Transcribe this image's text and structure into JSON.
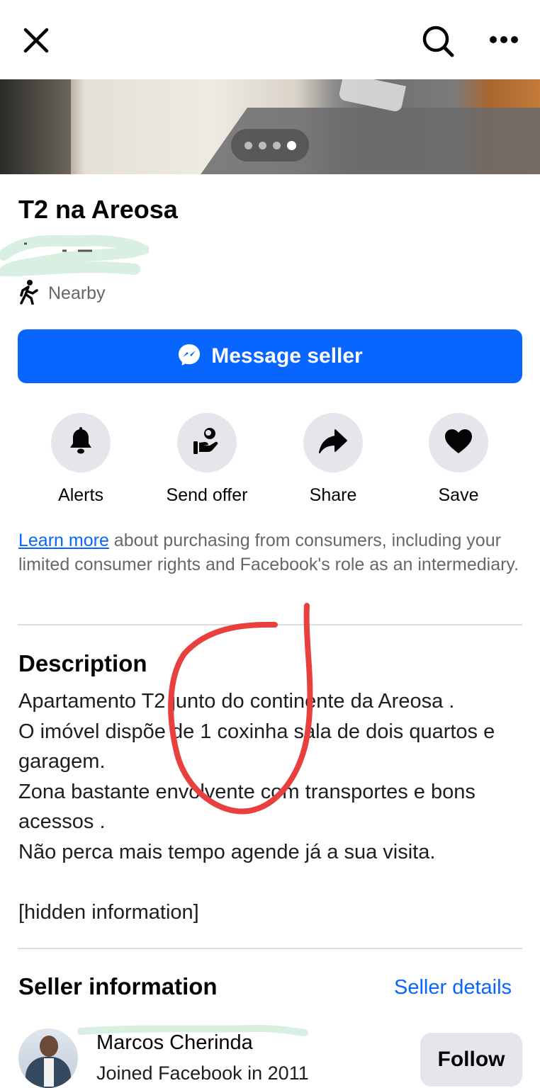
{
  "topbar": {
    "close_icon": "close-icon",
    "search_icon": "search-icon",
    "more_icon": "more-icon"
  },
  "gallery": {
    "photo_count": 4,
    "active_index": 4
  },
  "listing": {
    "title": "T2 na Areosa",
    "location_label": "Nearby",
    "location_icon": "walking-person-icon"
  },
  "message_button": {
    "label": "Message seller",
    "icon": "messenger-icon",
    "color": "#0866ff"
  },
  "actions": [
    {
      "label": "Alerts",
      "icon": "bell-icon"
    },
    {
      "label": "Send offer",
      "icon": "offer-hand-icon"
    },
    {
      "label": "Share",
      "icon": "share-arrow-icon"
    },
    {
      "label": "Save",
      "icon": "heart-icon"
    }
  ],
  "notice": {
    "link_text": "Learn more",
    "text": " about purchasing from consumers, including your limited consumer rights and Facebook's role as an intermediary."
  },
  "description": {
    "heading": "Description",
    "body": "Apartamento T2 junto do continente da Areosa .\nO imóvel dispõe de 1 coxinha sala de dois quartos e garagem.\nZona bastante envolvente com transportes e bons acessos .\nNão perca mais tempo agende já a sua visita.\n\n[hidden information]"
  },
  "seller": {
    "heading": "Seller information",
    "details_link": "Seller details",
    "name": "Marcos Cherinda",
    "joined": "Joined Facebook in 2011",
    "follow_label": "Follow"
  },
  "colors": {
    "accent": "#0866ff",
    "annotation": "#e8403f",
    "scribble": "#d8efe2"
  }
}
